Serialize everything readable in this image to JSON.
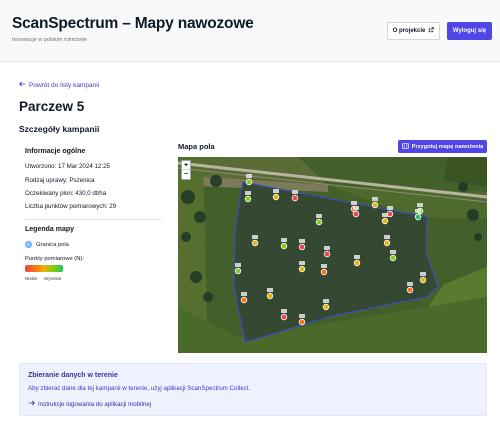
{
  "header": {
    "title": "ScanSpectrum – Mapy nawozowe",
    "subtitle": "Innowacje w polskim rolnictwie",
    "about_label": "O projekcie",
    "logout_label": "Wyloguj się"
  },
  "nav": {
    "back_label": "Powrót do listy kampanii"
  },
  "campaign": {
    "name": "Parczew 5",
    "details_title": "Szczegóły kampanii"
  },
  "info": {
    "title": "Informacje ogólne",
    "created": "Utworzono: 17 Mar 2024 12:25",
    "crop": "Rodzaj uprawy: Pszenica",
    "yield": "Oczekiwany plon: 430,0 dt/ha",
    "points": "Liczba punktów pomiarowych: 29"
  },
  "legend": {
    "title": "Legenda mapy",
    "boundary_label": "Granica pola",
    "points_label": "Punkty pomiarowe (N):",
    "low_label": "Niskie",
    "high_label": "Wysokie",
    "colors": [
      "#ef4444",
      "#f97316",
      "#eab308",
      "#84cc16",
      "#22c55e"
    ]
  },
  "map": {
    "title": "Mapa pola",
    "prepare_button_label": "Przygotuj mapę nawożenia",
    "zoom_in": "+",
    "zoom_out": "−",
    "boundary_color": "#3b4cc0",
    "points": [
      {
        "color": "#84cc16"
      },
      {
        "color": "#eab308"
      },
      {
        "color": "#84cc16"
      },
      {
        "color": "#ef4444"
      },
      {
        "color": "#84cc16"
      },
      {
        "color": "#f97316"
      },
      {
        "color": "#eab308"
      },
      {
        "color": "#ef4444"
      },
      {
        "color": "#ef4444"
      },
      {
        "color": "#eab308"
      },
      {
        "color": "#84cc16"
      },
      {
        "color": "#22c55e"
      },
      {
        "color": "#eab308"
      },
      {
        "color": "#84cc16"
      },
      {
        "color": "#ef4444"
      },
      {
        "color": "#ef4444"
      },
      {
        "color": "#eab308"
      },
      {
        "color": "#84cc16"
      },
      {
        "color": "#eab308"
      },
      {
        "color": "#f97316"
      },
      {
        "color": "#eab308"
      },
      {
        "color": "#84cc16"
      },
      {
        "color": "#f97316"
      },
      {
        "color": "#eab308"
      },
      {
        "color": "#f97316"
      },
      {
        "color": "#eab308"
      },
      {
        "color": "#ef4444"
      },
      {
        "color": "#f97316"
      },
      {
        "color": "#eab308"
      }
    ]
  },
  "collect": {
    "title": "Zbieranie danych w terenie",
    "text": "Aby zbierać dane dla tej kampanii w terenie, użyj aplikacji ScanSpectrum Collect.",
    "link_label": "Instrukcje logowania do aplikacji mobilnej"
  }
}
